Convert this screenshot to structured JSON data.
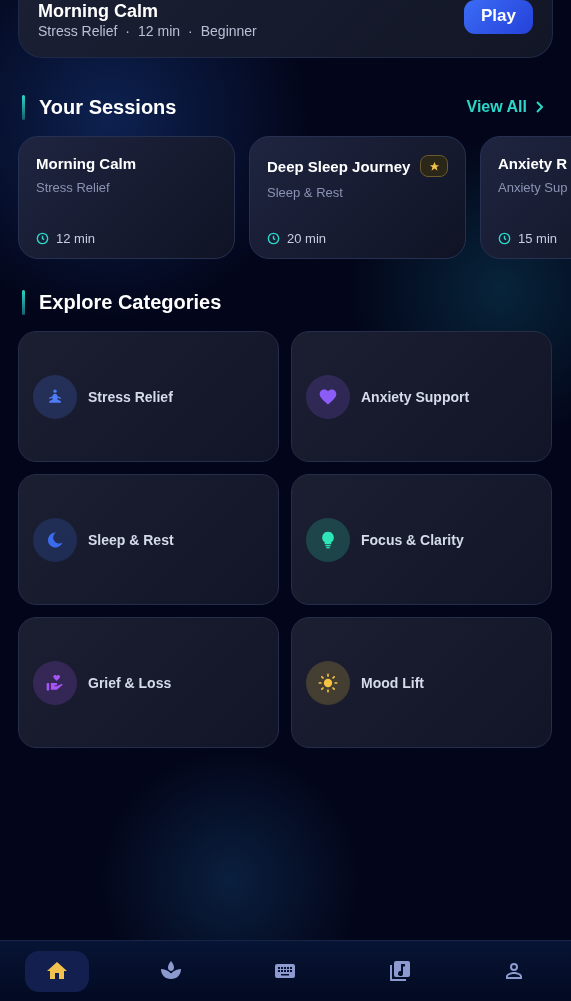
{
  "now_playing": {
    "title": "Morning Calm",
    "meta": [
      "Stress Relief",
      "·",
      "12 min",
      "·",
      "Beginner"
    ],
    "button": "Play"
  },
  "sessions_section": {
    "title": "Your Sessions",
    "link": "View All",
    "items": [
      {
        "title": "Morning Calm",
        "category": "Stress Relief",
        "duration": "12 min",
        "featured": false
      },
      {
        "title": "Deep Sleep Journey",
        "category": "Sleep & Rest",
        "duration": "20 min",
        "featured": true
      },
      {
        "title": "Anxiety R",
        "category": "Anxiety Sup",
        "duration": "15 min",
        "featured": false
      }
    ]
  },
  "categories_section": {
    "title": "Explore Categories",
    "items": [
      {
        "label": "Stress Relief",
        "color": "#4f7dfa"
      },
      {
        "label": "Anxiety Support",
        "color": "#8b5cf6"
      },
      {
        "label": "Sleep & Rest",
        "color": "#3b6cf0"
      },
      {
        "label": "Focus & Clarity",
        "color": "#2ee6b8"
      },
      {
        "label": "Grief & Loss",
        "color": "#a855f7"
      },
      {
        "label": "Mood Lift",
        "color": "#f5c542"
      }
    ]
  },
  "bottom_nav": [
    {
      "selected": true
    },
    {
      "selected": false
    },
    {
      "selected": false
    },
    {
      "selected": false
    },
    {
      "selected": false
    }
  ]
}
